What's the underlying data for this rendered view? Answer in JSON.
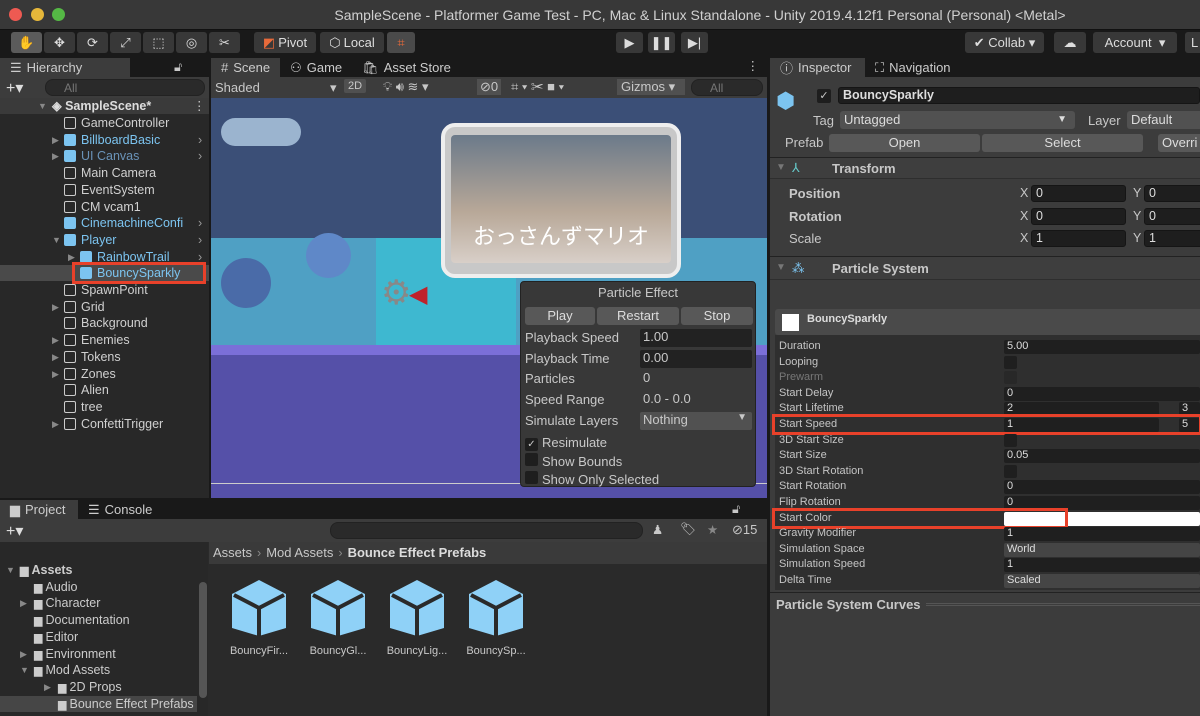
{
  "window": {
    "title": "SampleScene - Platformer Game Test - PC, Mac & Linux Standalone - Unity 2019.4.12f1 Personal (Personal) <Metal>"
  },
  "toolbar": {
    "tools": [
      "hand-icon",
      "move-icon",
      "rotate-icon",
      "scale-icon",
      "rect-icon",
      "transform-icon",
      "custom-tool-icon"
    ],
    "pivot": "Pivot",
    "local": "Local",
    "collab": "Collab",
    "account": "Account",
    "layers": "L"
  },
  "hierarchy": {
    "tab": "Hierarchy",
    "search_placeholder": "All",
    "scene": "SampleScene*",
    "items": [
      {
        "label": "GameController",
        "level": 1,
        "prefab": false,
        "arrow": false
      },
      {
        "label": "BillboardBasic",
        "level": 1,
        "prefab": true,
        "arrow": true
      },
      {
        "label": "UI Canvas",
        "level": 1,
        "prefab": true,
        "arrow": true,
        "dim": true
      },
      {
        "label": "Main Camera",
        "level": 1,
        "prefab": false,
        "arrow": false
      },
      {
        "label": "EventSystem",
        "level": 1,
        "prefab": false,
        "arrow": false
      },
      {
        "label": "CM vcam1",
        "level": 1,
        "prefab": false,
        "arrow": false
      },
      {
        "label": "CinemachineConfi",
        "level": 1,
        "prefab": true,
        "arrow": false
      },
      {
        "label": "Player",
        "level": 1,
        "prefab": true,
        "arrow": true,
        "expanded": true
      },
      {
        "label": "RainbowTrail",
        "level": 2,
        "prefab": true,
        "arrow": true
      },
      {
        "label": "BouncySparkly",
        "level": 2,
        "prefab": true,
        "arrow": false,
        "selected": true
      },
      {
        "label": "SpawnPoint",
        "level": 1,
        "prefab": false,
        "arrow": false
      },
      {
        "label": "Grid",
        "level": 1,
        "prefab": false,
        "arrow": true
      },
      {
        "label": "Background",
        "level": 1,
        "prefab": false,
        "arrow": false
      },
      {
        "label": "Enemies",
        "level": 1,
        "prefab": false,
        "arrow": true
      },
      {
        "label": "Tokens",
        "level": 1,
        "prefab": false,
        "arrow": true
      },
      {
        "label": "Zones",
        "level": 1,
        "prefab": false,
        "arrow": true
      },
      {
        "label": "Alien",
        "level": 1,
        "prefab": false,
        "arrow": false
      },
      {
        "label": "tree",
        "level": 1,
        "prefab": false,
        "arrow": false
      },
      {
        "label": "ConfettiTrigger",
        "level": 1,
        "prefab": false,
        "arrow": true
      }
    ]
  },
  "scene": {
    "tabs": [
      "Scene",
      "Game",
      "Asset Store"
    ],
    "shading": "Shaded",
    "mode_2d": "2D",
    "hidden_count": "0",
    "gizmos": "Gizmos",
    "search_placeholder": "All",
    "billboard_text": "おっさんずマリオ",
    "particle_effect": {
      "title": "Particle Effect",
      "play": "Play",
      "restart": "Restart",
      "stop": "Stop",
      "rows": [
        {
          "label": "Playback Speed",
          "value": "1.00",
          "field": true
        },
        {
          "label": "Playback Time",
          "value": "0.00",
          "field": true
        },
        {
          "label": "Particles",
          "value": "0"
        },
        {
          "label": "Speed Range",
          "value": "0.0 - 0.0"
        },
        {
          "label": "Simulate Layers",
          "value": "Nothing",
          "dropdown": true
        }
      ],
      "checks": [
        {
          "label": "Resimulate",
          "checked": true
        },
        {
          "label": "Show Bounds",
          "checked": false
        },
        {
          "label": "Show Only Selected",
          "checked": false
        }
      ]
    }
  },
  "inspector": {
    "tabs": [
      "Inspector",
      "Navigation"
    ],
    "object_name": "BouncySparkly",
    "active": true,
    "tag_label": "Tag",
    "tag": "Untagged",
    "layer_label": "Layer",
    "layer": "Default",
    "prefab_label": "Prefab",
    "open": "Open",
    "select": "Select",
    "overrides": "Overri",
    "transform": {
      "title": "Transform",
      "rows": [
        {
          "label": "Position",
          "x": "0",
          "y": "0"
        },
        {
          "label": "Rotation",
          "x": "0",
          "y": "0"
        },
        {
          "label": "Scale",
          "x": "1",
          "y": "1"
        }
      ]
    },
    "particle_system": {
      "title": "Particle System",
      "module": "BouncySparkly",
      "rows": [
        {
          "label": "Duration",
          "value": "5.00"
        },
        {
          "label": "Looping",
          "check": true
        },
        {
          "label": "Prewarm",
          "check": true,
          "disabled": true
        },
        {
          "label": "Start Delay",
          "value": "0"
        },
        {
          "label": "Start Lifetime",
          "value": "2",
          "value2": "3"
        },
        {
          "label": "Start Speed",
          "value": "1",
          "value2": "5",
          "highlight": true
        },
        {
          "label": "3D Start Size",
          "check": true
        },
        {
          "label": "Start Size",
          "value": "0.05"
        },
        {
          "label": "3D Start Rotation",
          "check": true
        },
        {
          "label": "Start Rotation",
          "value": "0"
        },
        {
          "label": "Flip Rotation",
          "value": "0"
        },
        {
          "label": "Start Color",
          "color": "#ffffff",
          "highlight": true
        },
        {
          "label": "Gravity Modifier",
          "value": "1"
        },
        {
          "label": "Simulation Space",
          "value": "World",
          "dropdown": true
        },
        {
          "label": "Simulation Speed",
          "value": "1"
        },
        {
          "label": "Delta Time",
          "value": "Scaled",
          "dropdown": true
        }
      ]
    },
    "curves": "Particle System Curves"
  },
  "project": {
    "tabs": [
      "Project",
      "Console"
    ],
    "hidden_count": "15",
    "breadcrumb": [
      "Assets",
      "Mod Assets",
      "Bounce Effect Prefabs"
    ],
    "tree": [
      {
        "label": "Assets",
        "level": 0,
        "arrow": "open",
        "bold": true
      },
      {
        "label": "Audio",
        "level": 1,
        "arrow": ""
      },
      {
        "label": "Character",
        "level": 1,
        "arrow": "closed"
      },
      {
        "label": "Documentation",
        "level": 1,
        "arrow": ""
      },
      {
        "label": "Editor",
        "level": 1,
        "arrow": ""
      },
      {
        "label": "Environment",
        "level": 1,
        "arrow": "closed"
      },
      {
        "label": "Mod Assets",
        "level": 1,
        "arrow": "open"
      },
      {
        "label": "2D Props",
        "level": 2,
        "arrow": "closed"
      },
      {
        "label": "Bounce Effect Prefabs",
        "level": 2,
        "arrow": "",
        "selected": true
      }
    ],
    "assets": [
      "BouncyFir...",
      "BouncyGl...",
      "BouncyLig...",
      "BouncySp..."
    ]
  },
  "colors": {
    "highlight": "#e8412a",
    "prefab_blue": "#7cc4f0",
    "panel": "#282828"
  }
}
